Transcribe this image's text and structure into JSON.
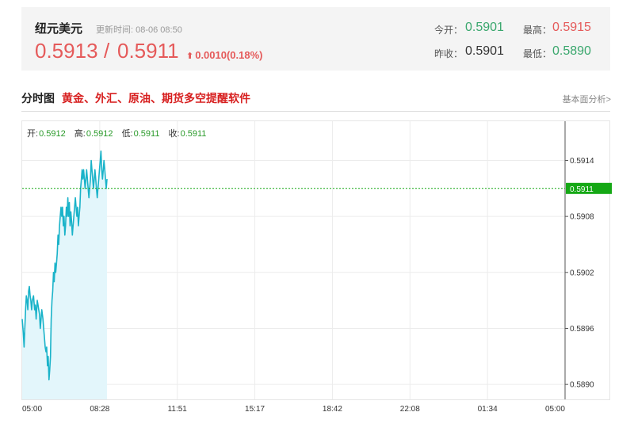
{
  "quote": {
    "name": "纽元美元",
    "update_label": "更新时间: 08-06 08:50",
    "bid": "0.5913",
    "ask": "0.5911",
    "change_arrow": "⬆",
    "change": "0.0010(0.18%)",
    "open_label": "今开：",
    "open": "0.5901",
    "high_label": "最高：",
    "high": "0.5915",
    "prev_close_label": "昨收：",
    "prev_close": "0.5901",
    "low_label": "最低：",
    "low": "0.5890"
  },
  "section": {
    "title": "分时图",
    "promo": "黄金、外汇、原油、期货多空提醒软件",
    "fundamental_link": "基本面分析>"
  },
  "ohlc": {
    "open_label": "开:",
    "open": "0.5912",
    "high_label": "高:",
    "high": "0.5912",
    "low_label": "低:",
    "low": "0.5911",
    "close_label": "收:",
    "close": "0.5911"
  },
  "colors": {
    "line": "#1ab3c9",
    "area": "#e3f6fb",
    "current_marker": "#15a815",
    "up": "#e55a5a",
    "down": "#3aa76d"
  },
  "chart_data": {
    "type": "area",
    "x_tick_labels": [
      "05:00",
      "08:28",
      "11:51",
      "15:17",
      "18:42",
      "22:08",
      "01:34",
      "05:00"
    ],
    "y_tick_labels": [
      "0.5914",
      "0.5908",
      "0.5902",
      "0.5896",
      "0.5890"
    ],
    "y_ticks": [
      0.5914,
      0.5908,
      0.5902,
      0.5896,
      0.589
    ],
    "ylim": [
      0.58884,
      0.59182
    ],
    "current_price": 0.5911,
    "current_label": "0.5911",
    "x_unit": "minutes since 05:00",
    "x_range": [
      0,
      1440
    ],
    "series": [
      {
        "x": [
          0,
          3,
          5,
          7,
          9,
          11,
          13,
          15,
          17,
          19,
          21,
          23,
          25,
          27,
          30,
          33,
          35,
          37,
          40,
          42,
          44,
          46,
          48,
          50,
          52,
          55,
          57,
          59,
          61,
          63,
          65,
          67,
          69,
          71,
          73,
          75,
          77,
          79,
          81,
          83,
          85,
          87,
          89,
          91,
          93,
          95,
          97,
          99,
          101,
          103,
          105,
          107,
          109,
          111,
          113,
          115,
          117,
          119,
          121,
          123,
          125,
          127,
          129,
          131,
          133,
          135,
          137,
          139,
          141,
          143,
          145,
          147,
          149,
          151,
          153,
          155,
          157,
          159,
          161,
          163,
          165,
          167,
          169,
          171,
          173,
          175,
          177,
          179,
          181,
          183,
          185,
          187,
          189,
          191,
          193,
          195,
          197,
          199,
          201,
          203,
          205,
          207,
          209,
          211,
          213,
          215,
          217,
          219,
          221,
          223,
          225
        ],
        "y": [
          0.5897,
          0.58955,
          0.5894,
          0.5896,
          0.5898,
          0.58995,
          0.5899,
          0.5898,
          0.59,
          0.59005,
          0.58995,
          0.5899,
          0.5898,
          0.5899,
          0.58995,
          0.5898,
          0.58985,
          0.5897,
          0.5899,
          0.58985,
          0.5898,
          0.58975,
          0.5896,
          0.5897,
          0.5898,
          0.5897,
          0.5896,
          0.5895,
          0.5894,
          0.58935,
          0.5894,
          0.5892,
          0.5893,
          0.58905,
          0.58915,
          0.5893,
          0.5897,
          0.5899,
          0.59,
          0.5902,
          0.5901,
          0.5903,
          0.5902,
          0.5903,
          0.5904,
          0.5906,
          0.5905,
          0.5907,
          0.5908,
          0.5909,
          0.5908,
          0.5909,
          0.5907,
          0.5908,
          0.5906,
          0.5907,
          0.5909,
          0.5908,
          0.591,
          0.5908,
          0.59095,
          0.5907,
          0.59085,
          0.59075,
          0.5906,
          0.5907,
          0.5908,
          0.5909,
          0.591,
          0.5909,
          0.5908,
          0.5909,
          0.5907,
          0.5908,
          0.5909,
          0.5911,
          0.5912,
          0.5913,
          0.5912,
          0.5913,
          0.5912,
          0.5911,
          0.5912,
          0.5913,
          0.5912,
          0.5911,
          0.591,
          0.5911,
          0.5912,
          0.5914,
          0.5913,
          0.5912,
          0.5911,
          0.5912,
          0.5913,
          0.5912,
          0.5911,
          0.591,
          0.5911,
          0.5912,
          0.5913,
          0.5914,
          0.5915,
          0.5913,
          0.5912,
          0.5913,
          0.5914,
          0.5913,
          0.5912,
          0.5911,
          0.5912
        ]
      }
    ],
    "grid": true
  }
}
